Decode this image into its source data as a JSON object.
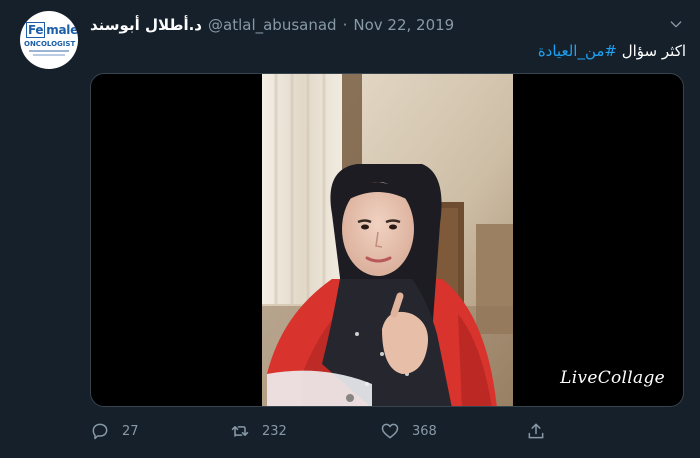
{
  "tweet": {
    "display_name": "د.أطلال أبوسند",
    "handle": "@atlal_abusanad",
    "separator": "·",
    "date": "Nov 22, 2019",
    "text_plain": "اكثر سؤال ",
    "hashtag": "#من_العيادة"
  },
  "avatar": {
    "logo_top_boxed": "Fe",
    "logo_top_rest": "male",
    "logo_bottom": "ONCOLOGIST"
  },
  "media": {
    "watermark": "LiveCollage"
  },
  "actions": {
    "reply_count": "27",
    "retweet_count": "232",
    "like_count": "368"
  },
  "colors": {
    "background": "#15202b",
    "accent": "#1da1f2",
    "muted": "#8899a6",
    "border": "#38444d"
  }
}
